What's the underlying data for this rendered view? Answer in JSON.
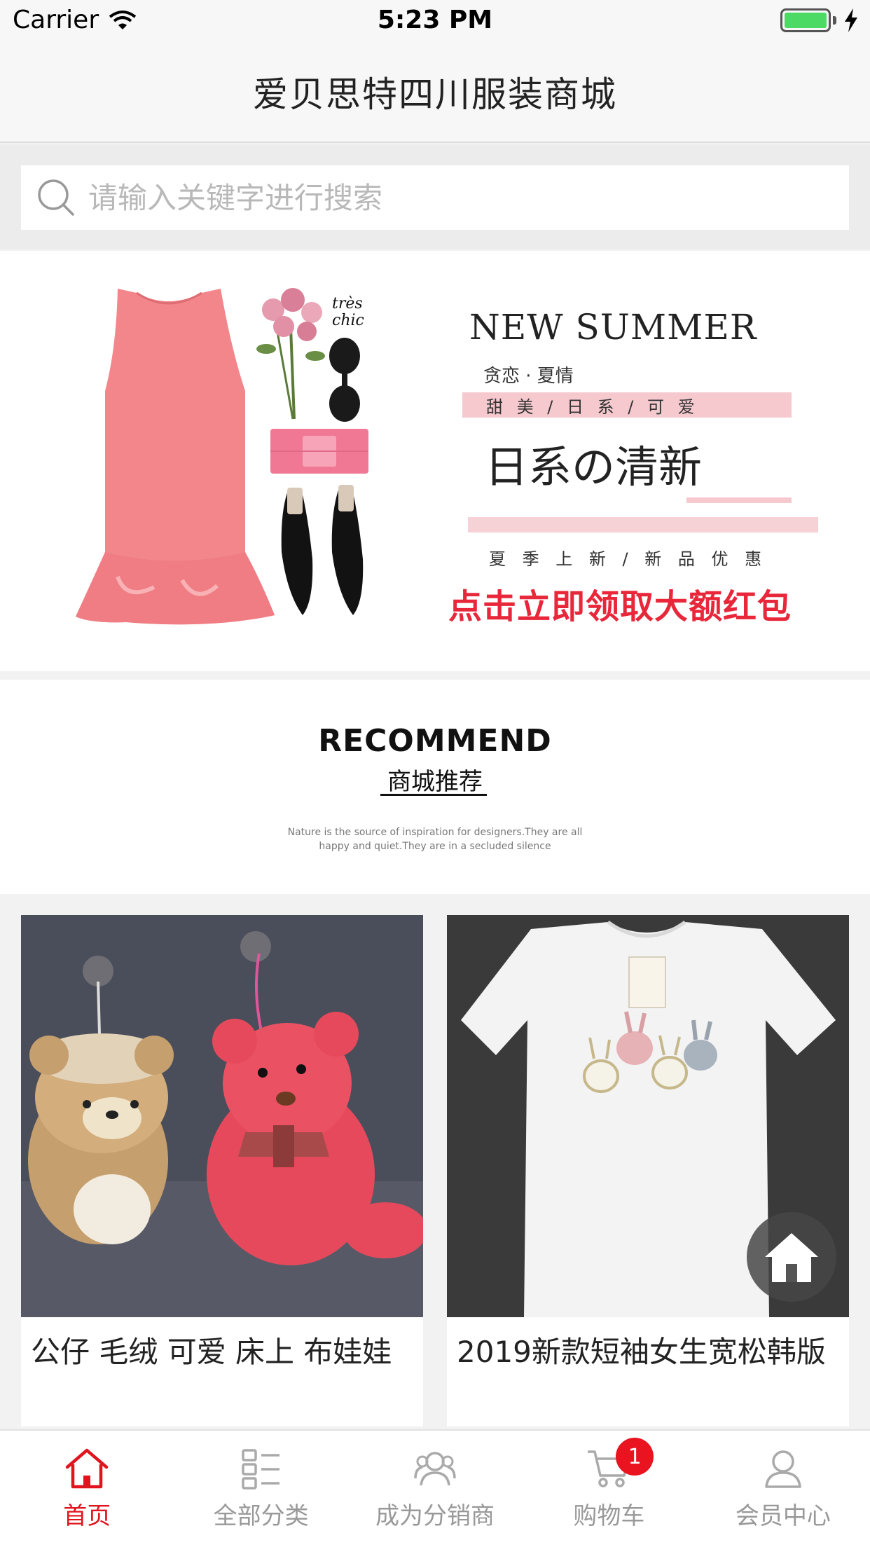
{
  "status_bar": {
    "carrier": "Carrier",
    "time": "5:23 PM"
  },
  "header": {
    "title": "爱贝思特四川服装商城"
  },
  "search": {
    "placeholder": "请输入关键字进行搜索"
  },
  "banner": {
    "headline": "NEW SUMMER",
    "sub1": "贪恋 · 夏情",
    "tags": "甜 美  /  日 系  /  可 爱",
    "big_text": "日系の清新",
    "sub2": "夏 季 上 新 / 新 品 优 惠",
    "cta": "点击立即领取大额红包",
    "logo_text": "très chic"
  },
  "recommend": {
    "title_en": "RECOMMEND",
    "title_cn": "商城推荐",
    "description": "Nature is the source of inspiration for designers.They are all happy and quiet.They are in a secluded silence"
  },
  "products": [
    {
      "name": "公仔 毛绒 可爱 床上 布娃娃"
    },
    {
      "name": "2019新款短袖女生宽松韩版"
    }
  ],
  "tabs": [
    {
      "label": "首页",
      "icon": "home-icon",
      "active": true
    },
    {
      "label": "全部分类",
      "icon": "category-icon",
      "active": false
    },
    {
      "label": "成为分销商",
      "icon": "distributor-icon",
      "active": false
    },
    {
      "label": "购物车",
      "icon": "cart-icon",
      "active": false,
      "badge": "1"
    },
    {
      "label": "会员中心",
      "icon": "member-icon",
      "active": false
    }
  ],
  "colors": {
    "accent": "#e0141e",
    "banner_pink": "#f6c9cf",
    "cta_red": "#e8273a"
  }
}
